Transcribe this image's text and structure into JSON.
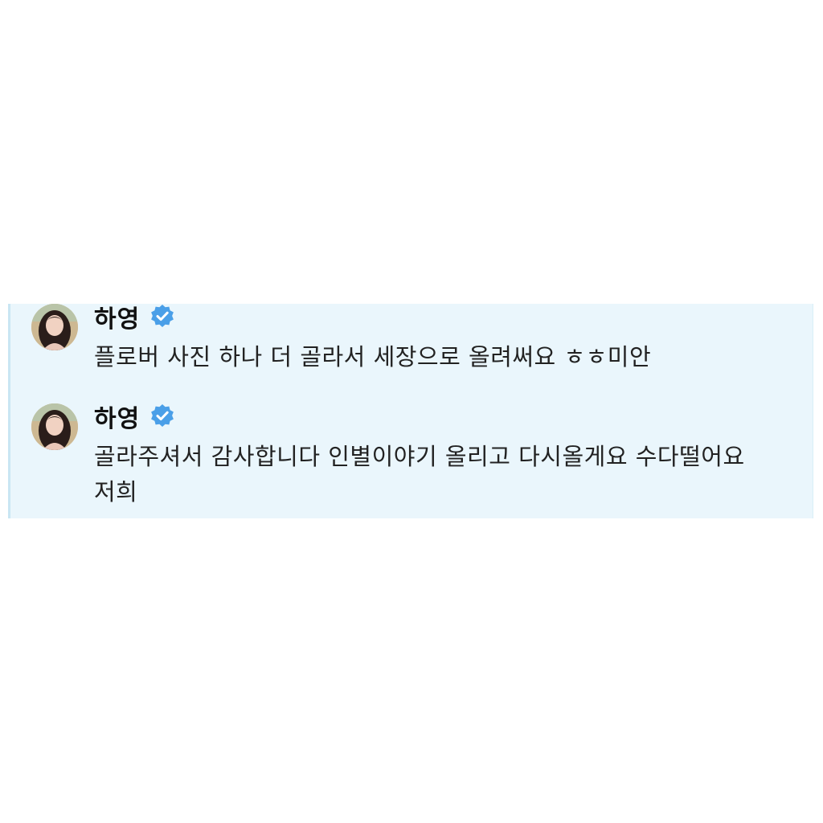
{
  "messages": [
    {
      "sender": "하영",
      "verified": true,
      "avatar_icon": "profile-photo",
      "text": "플로버 사진 하나 더 골라서 세장으로 올려써요 ㅎㅎ미안"
    },
    {
      "sender": "하영",
      "verified": true,
      "avatar_icon": "profile-photo",
      "text": "골라주셔서 감사합니다 인별이야기 올리고 다시올게요 수다떨어요 저희"
    }
  ],
  "colors": {
    "panel_background": "#eaf6fc",
    "verified_badge": "#4a9fe8",
    "text": "#222222"
  }
}
